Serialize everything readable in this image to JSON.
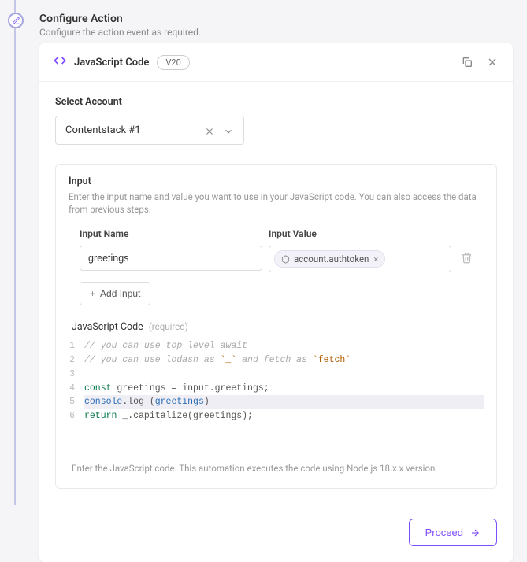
{
  "header": {
    "title": "Configure Action",
    "subtitle": "Configure the action event as required."
  },
  "card": {
    "title": "JavaScript Code",
    "version": "V20"
  },
  "account": {
    "label": "Select Account",
    "value": "Contentstack #1"
  },
  "inputPanel": {
    "title": "Input",
    "description": "Enter the input name and value you want to use in your JavaScript code. You can also access the data from previous steps.",
    "nameLabel": "Input Name",
    "valueLabel": "Input Value",
    "nameValue": "greetings",
    "tokenValue": "account.authtoken",
    "addButton": "Add Input"
  },
  "codeSection": {
    "title": "JavaScript Code",
    "required": "(required)",
    "lines": {
      "l1": "// you can use top level await",
      "l2_a": "// you can use lodash as ",
      "l2_b": "`_`",
      "l2_c": " and fetch as ",
      "l2_d": "`fetch`",
      "l4_a": "const",
      "l4_b": " greetings = input.greetings;",
      "l5_a": "console",
      "l5_b": ".log (",
      "l5_c": "greetings",
      "l5_d": ")",
      "l6_a": "return",
      "l6_b": " _.capitalize(greetings);"
    },
    "footnote": "Enter the JavaScript code. This automation executes the code using Node.js 18.x.x version."
  },
  "footer": {
    "proceed": "Proceed"
  }
}
